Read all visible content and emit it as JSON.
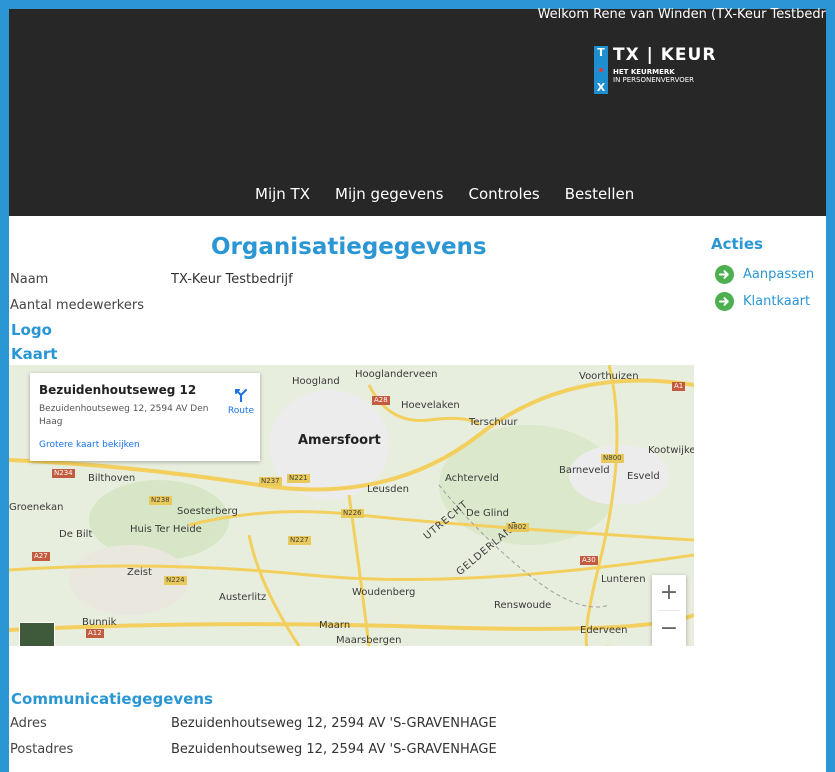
{
  "header": {
    "welcome": "Welkom Rene van Winden (TX-Keur Testbedr",
    "logo": {
      "badge_top": "T",
      "badge_bottom": "X",
      "title": "TX | KEUR",
      "sub1": "HET KEURMERK",
      "sub2": "IN PERSONENVERVOER"
    },
    "nav": [
      "Mijn TX",
      "Mijn gegevens",
      "Controles",
      "Bestellen"
    ]
  },
  "page": {
    "title": "Organisatiegegevens",
    "fields": [
      {
        "label": "Naam",
        "value": "TX-Keur Testbedrijf"
      },
      {
        "label": "Aantal medewerkers",
        "value": ""
      }
    ],
    "section_logo": "Logo",
    "section_kaart": "Kaart",
    "section_comm": "Communicatiegegevens",
    "comm_fields": [
      {
        "label": "Adres",
        "value": "Bezuidenhoutseweg 12, 2594 AV 'S-GRAVENHAGE"
      },
      {
        "label": "Postadres",
        "value": "Bezuidenhoutseweg 12, 2594 AV 'S-GRAVENHAGE"
      }
    ]
  },
  "actions": {
    "title": "Acties",
    "items": [
      "Aanpassen",
      "Klantkaart"
    ]
  },
  "map": {
    "infowindow": {
      "title": "Bezuidenhoutseweg 12",
      "address": "Bezuidenhoutseweg 12, 2594 AV Den Haag",
      "route_label": "Route",
      "larger_map_link": "Grotere kaart bekijken"
    },
    "places": [
      "Amersfoort",
      "Hoogland",
      "Hooglanderveen",
      "Hoevelaken",
      "Terschuur",
      "Voorthuizen",
      "Bilthoven",
      "Leusden",
      "Achterveld",
      "Barneveld",
      "Esveld",
      "Kootwijker",
      "Groenekan",
      "Soesterberg",
      "Huis Ter Heide",
      "De Bilt",
      "De Glind",
      "Zeist",
      "Austerlitz",
      "Woudenberg",
      "Renswoude",
      "Lunteren",
      "Ederveen",
      "Bunnik",
      "Maarn",
      "Maarsbergen",
      "UTRECHT",
      "GELDERLAND"
    ],
    "roads": [
      "A1",
      "A28",
      "N234",
      "N237",
      "N221",
      "N238",
      "N226",
      "N227",
      "N224",
      "N800",
      "N802",
      "A30",
      "A12",
      "A27"
    ],
    "zoom_in": "+",
    "zoom_out": "−"
  }
}
